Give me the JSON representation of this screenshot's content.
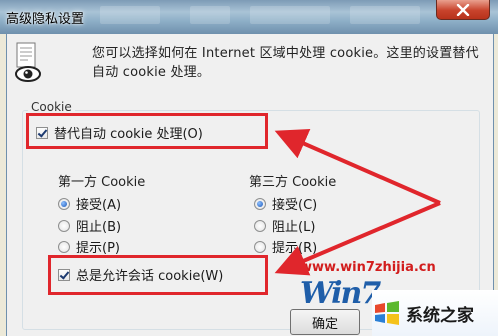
{
  "window": {
    "title": "高级隐私设置",
    "close_icon": "close-icon"
  },
  "description": "您可以选择如何在 Internet 区域中处理 cookie。这里的设置替代自动 cookie 处理。",
  "cookie_group": {
    "label": "Cookie",
    "override_auto": {
      "label": "替代自动 cookie 处理(O)",
      "checked": true
    },
    "first_party": {
      "title": "第一方 Cookie",
      "options": [
        {
          "label": "接受(A)",
          "selected": true
        },
        {
          "label": "阻止(B)",
          "selected": false
        },
        {
          "label": "提示(P)",
          "selected": false
        }
      ]
    },
    "third_party": {
      "title": "第三方 Cookie",
      "options": [
        {
          "label": "接受(C)",
          "selected": true
        },
        {
          "label": "阻止(L)",
          "selected": false
        },
        {
          "label": "提示(R)",
          "selected": false
        }
      ]
    },
    "always_allow_session": {
      "label": "总是允许会话 cookie(W)",
      "checked": true
    }
  },
  "buttons": {
    "ok_label": "确定"
  },
  "watermark": {
    "url": "www.win7zhijia.cn",
    "logo_text": "Win7",
    "site_name": "系统之家"
  },
  "colors": {
    "annotation_red": "#e0262c",
    "titlebar": "#8fb0c8"
  }
}
